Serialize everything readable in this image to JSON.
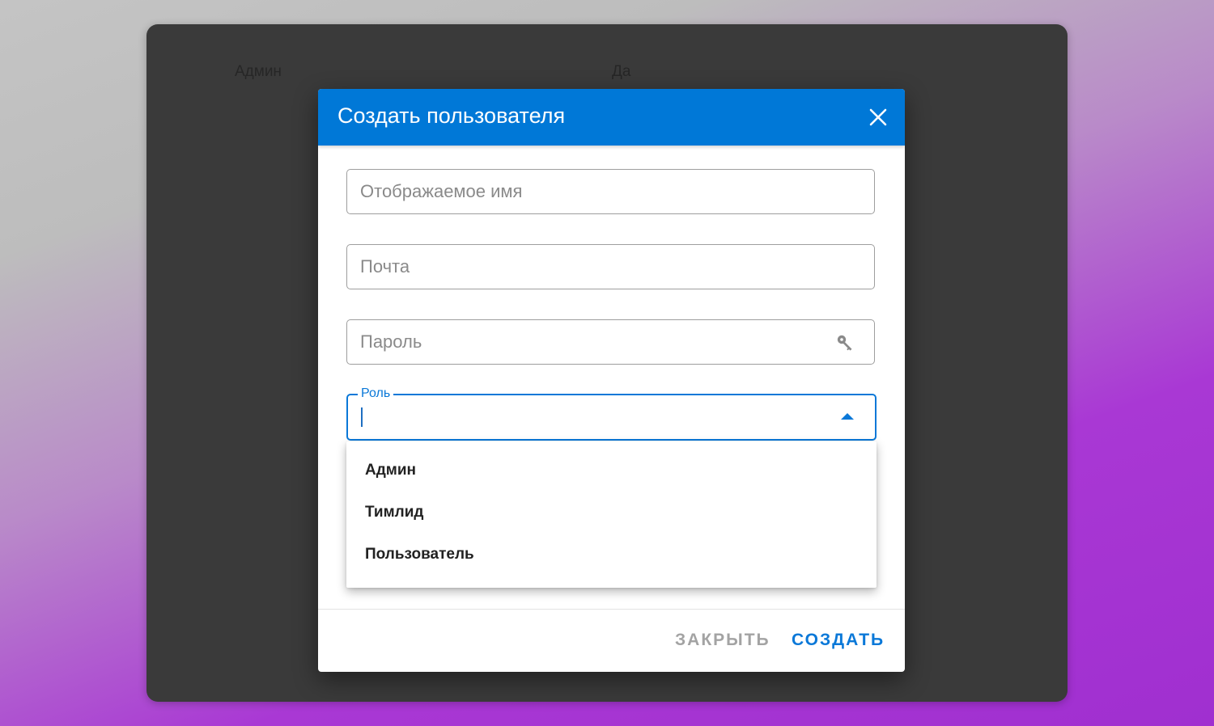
{
  "background_table": {
    "row": {
      "role": "Админ",
      "flag": "Да"
    }
  },
  "dialog": {
    "title": "Создать пользователя",
    "close_icon": "close-icon",
    "fields": {
      "display_name": {
        "placeholder": "Отображаемое имя",
        "value": ""
      },
      "email": {
        "placeholder": "Почта",
        "value": ""
      },
      "password": {
        "placeholder": "Пароль",
        "value": "",
        "icon": "key-icon"
      }
    },
    "role_select": {
      "label": "Роль",
      "value": "",
      "open": true,
      "options": [
        "Админ",
        "Тимлид",
        "Пользователь"
      ]
    },
    "actions": {
      "close_label": "ЗАКРЫТЬ",
      "create_label": "СОЗДАТЬ"
    }
  },
  "colors": {
    "accent": "#0078d7",
    "window_bg": "#3a3a3a",
    "muted_button": "#a3a3a3"
  }
}
